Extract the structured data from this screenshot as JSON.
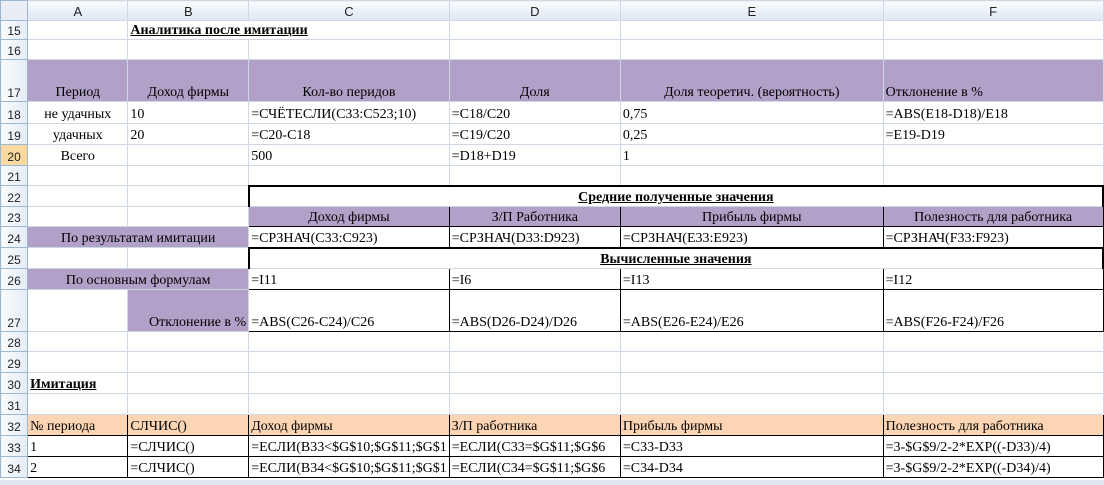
{
  "columns": [
    "A",
    "B",
    "C",
    "D",
    "E",
    "F"
  ],
  "rows": {
    "r15": {
      "num": "15",
      "b": "Аналитика после имитации"
    },
    "r16": {
      "num": "16"
    },
    "r17": {
      "num": "17",
      "a": "Период",
      "b": "Доход фирмы",
      "c": "Кол-во перидов",
      "d": "Доля",
      "e": "Доля теоретич. (вероятность)",
      "f": "Отклонение в %"
    },
    "r18": {
      "num": "18",
      "a": "не удачных",
      "b": "10",
      "c": "=СЧЁТЕСЛИ(C33:C523;10)",
      "d": "=C18/C20",
      "e": "0,75",
      "f": "=ABS(E18-D18)/E18"
    },
    "r19": {
      "num": "19",
      "a": "удачных",
      "b": "20",
      "c": "=C20-C18",
      "d": "=C19/C20",
      "e": "0,25",
      "f": "=E19-D19"
    },
    "r20": {
      "num": "20",
      "a": "Всего",
      "c": "500",
      "d": "=D18+D19",
      "e": "1"
    },
    "r21": {
      "num": "21"
    },
    "r22": {
      "num": "22",
      "cf": "Средние полученные значения"
    },
    "r23": {
      "num": "23",
      "c": "Доход фирмы",
      "d": "З/П Работника",
      "e": "Прибыль фирмы",
      "f": "Полезность для работника"
    },
    "r24": {
      "num": "24",
      "ab": "По результатам имитации",
      "c": "=СРЗНАЧ(C33:C923)",
      "d": "=СРЗНАЧ(D33:D923)",
      "e": "=СРЗНАЧ(E33:E923)",
      "f": "=СРЗНАЧ(F33:F923)"
    },
    "r25": {
      "num": "25",
      "cf": "Вычисленные значения"
    },
    "r26": {
      "num": "26",
      "ab": "По основным формулам",
      "c": "=I11",
      "d": "=I6",
      "e": "=I13",
      "f": "=I12"
    },
    "r27": {
      "num": "27",
      "b": "Отклонение в %",
      "c": "=ABS(C26-C24)/C26",
      "d": "=ABS(D26-D24)/D26",
      "e": "=ABS(E26-E24)/E26",
      "f": "=ABS(F26-F24)/F26"
    },
    "r28": {
      "num": "28"
    },
    "r29": {
      "num": "29"
    },
    "r30": {
      "num": "30",
      "a": "Имитация"
    },
    "r31": {
      "num": "31"
    },
    "r32": {
      "num": "32",
      "a": "№ периода",
      "b": "СЛЧИС()",
      "c": "Доход фирмы",
      "d": "З/П работника",
      "e": "Прибыль фирмы",
      "f": "Полезность для работника"
    },
    "r33": {
      "num": "33",
      "a": "1",
      "b": "=СЛЧИС()",
      "c": "=ЕСЛИ(B33<$G$10;$G$11;$G$1",
      "d": "=ЕСЛИ(C33=$G$11;$G$6",
      "e": "=C33-D33",
      "f": "=3-$G$9/2-2*EXP((-D33)/4)"
    },
    "r34": {
      "num": "34",
      "a": "2",
      "b": "=СЛЧИС()",
      "c": "=ЕСЛИ(B34<$G$10;$G$11;$G$1",
      "d": "=ЕСЛИ(C34=$G$11;$G$6",
      "e": "=C34-D34",
      "f": "=3-$G$9/2-2*EXP((-D34)/4)"
    }
  },
  "colors": {
    "purple": "#b1a0c7",
    "orange": "#fcd5b4",
    "active_row": "#f9d99f"
  }
}
